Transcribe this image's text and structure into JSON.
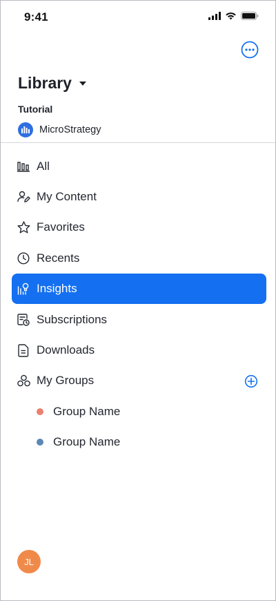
{
  "status_bar": {
    "time": "9:41"
  },
  "header": {
    "title": "Library",
    "environment_label": "Tutorial",
    "application_name": "MicroStrategy"
  },
  "nav": {
    "items": [
      {
        "label": "All",
        "icon": "bar-chart-icon",
        "active": false
      },
      {
        "label": "My Content",
        "icon": "user-edit-icon",
        "active": false
      },
      {
        "label": "Favorites",
        "icon": "star-icon",
        "active": false
      },
      {
        "label": "Recents",
        "icon": "clock-icon",
        "active": false
      },
      {
        "label": "Insights",
        "icon": "insights-icon",
        "active": true
      },
      {
        "label": "Subscriptions",
        "icon": "subscriptions-icon",
        "active": false
      },
      {
        "label": "Downloads",
        "icon": "document-icon",
        "active": false
      },
      {
        "label": "My Groups",
        "icon": "groups-icon",
        "active": false
      }
    ]
  },
  "groups": [
    {
      "label": "Group Name",
      "color": "#e9826f"
    },
    {
      "label": "Group Name",
      "color": "#5b87b5"
    }
  ],
  "user": {
    "initials": "JL"
  },
  "colors": {
    "accent": "#1470f0",
    "avatar": "#f08a4b"
  }
}
